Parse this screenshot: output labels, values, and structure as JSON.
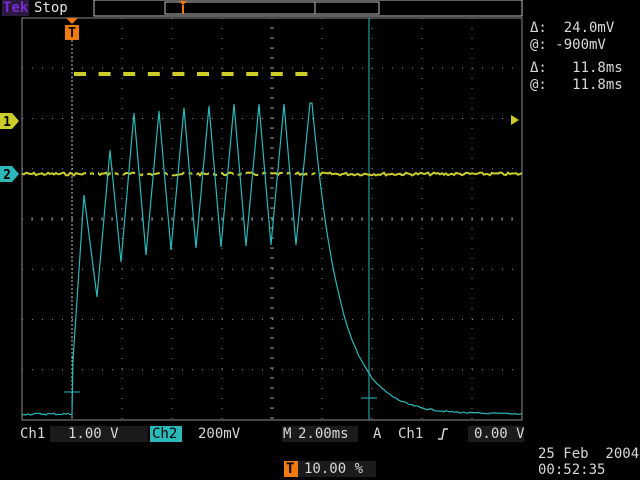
{
  "header": {
    "brand": "Tek",
    "acq_state": "Stop"
  },
  "markers": {
    "trigger_position_label": "T",
    "ch1_label": "1",
    "ch2_label": "2"
  },
  "cursor_readout": {
    "voltage_delta": "Δ:  24.0mV",
    "voltage_at": "@: -900mV",
    "time_delta": "Δ:   11.8ms",
    "time_at": "@:   11.8ms"
  },
  "bottom_bar": {
    "ch1_name": "Ch1",
    "ch1_scale": "1.00 V",
    "ch2_name": "Ch2",
    "ch2_scale": "200mV",
    "timebase_prefix": "M",
    "timebase_value": "2.00ms",
    "trigger_mode": "A",
    "trigger_source": "Ch1",
    "trigger_slope_icon": "rising-edge-icon",
    "trigger_level": "0.00 V"
  },
  "footer": {
    "trigger_pos_icon_label": "T",
    "trigger_pos_value": "10.00 %",
    "date": "25 Feb  2004",
    "time": "00:52:35"
  },
  "colors": {
    "ch1": "#cccc2a",
    "ch2": "#2ab8b8",
    "grid": "#8a8a8a",
    "trigger_marker": "#f07a10"
  },
  "traces": {
    "ch1": {
      "label": "Ch1",
      "baseline_div": -0.45,
      "pulse_high_div": 2.5,
      "pulse_count": 10,
      "pulse_start_ms": 0.5,
      "pulse_period_ms": 1.0,
      "pulse_width_ms": 0.4
    },
    "ch2": {
      "label": "Ch2",
      "pre_trigger_div": -3.95,
      "peak_count": 10,
      "decay_after_ms": 9.6
    }
  }
}
